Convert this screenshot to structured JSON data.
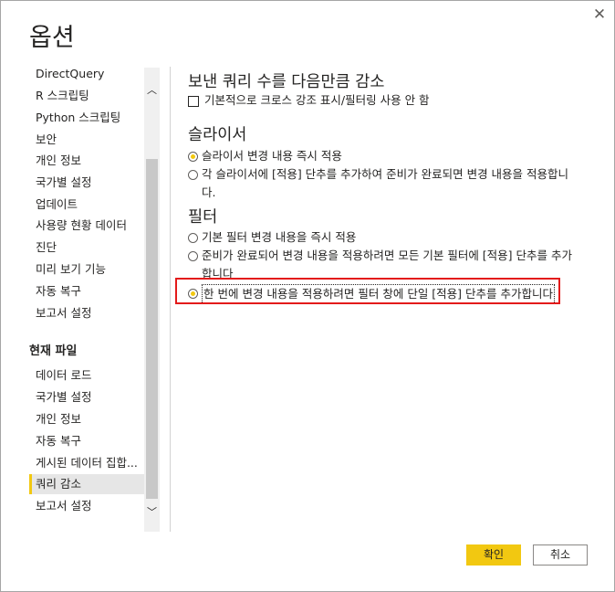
{
  "dialog": {
    "title": "옵션",
    "close_icon": "close-icon"
  },
  "sidebar": {
    "global_items": [
      {
        "label": "DirectQuery"
      },
      {
        "label": "R 스크립팅"
      },
      {
        "label": "Python 스크립팅"
      },
      {
        "label": "보안"
      },
      {
        "label": "개인 정보"
      },
      {
        "label": "국가별 설정"
      },
      {
        "label": "업데이트"
      },
      {
        "label": "사용량 현황 데이터"
      },
      {
        "label": "진단"
      },
      {
        "label": "미리 보기 기능"
      },
      {
        "label": "자동 복구"
      },
      {
        "label": "보고서 설정"
      }
    ],
    "current_file_header": "현재 파일",
    "current_file_items": [
      {
        "label": "데이터 로드"
      },
      {
        "label": "국가별 설정"
      },
      {
        "label": "개인 정보"
      },
      {
        "label": "자동 복구"
      },
      {
        "label": "게시된 데이터 집합..."
      },
      {
        "label": "쿼리 감소",
        "selected": true
      },
      {
        "label": "보고서 설정"
      }
    ]
  },
  "content": {
    "reduce_queries": {
      "heading": "보낸 쿼리 수를 다음만큼 감소",
      "checkbox_label": "기본적으로 크로스 강조 표시/필터링 사용 안 함",
      "checked": false
    },
    "slicers": {
      "heading": "슬라이서",
      "options": [
        {
          "label": "슬라이서 변경 내용 즉시 적용",
          "checked": true
        },
        {
          "label": "각 슬라이서에 [적용] 단추를 추가하여 준비가 완료되면 변경 내용을 적용합니다.",
          "checked": false
        }
      ]
    },
    "filters": {
      "heading": "필터",
      "options": [
        {
          "label": "기본 필터 변경 내용을 즉시 적용",
          "checked": false
        },
        {
          "label": "준비가 완료되어 변경 내용을 적용하려면 모든 기본 필터에 [적용] 단추를 추가합니다",
          "checked": false
        },
        {
          "label": "한 번에 변경 내용을 적용하려면 필터 창에 단일 [적용] 단추를 추가합니다",
          "checked": true
        }
      ]
    }
  },
  "buttons": {
    "ok": "확인",
    "cancel": "취소"
  },
  "colors": {
    "accent": "#f2c811",
    "highlight": "#e31b1b"
  }
}
